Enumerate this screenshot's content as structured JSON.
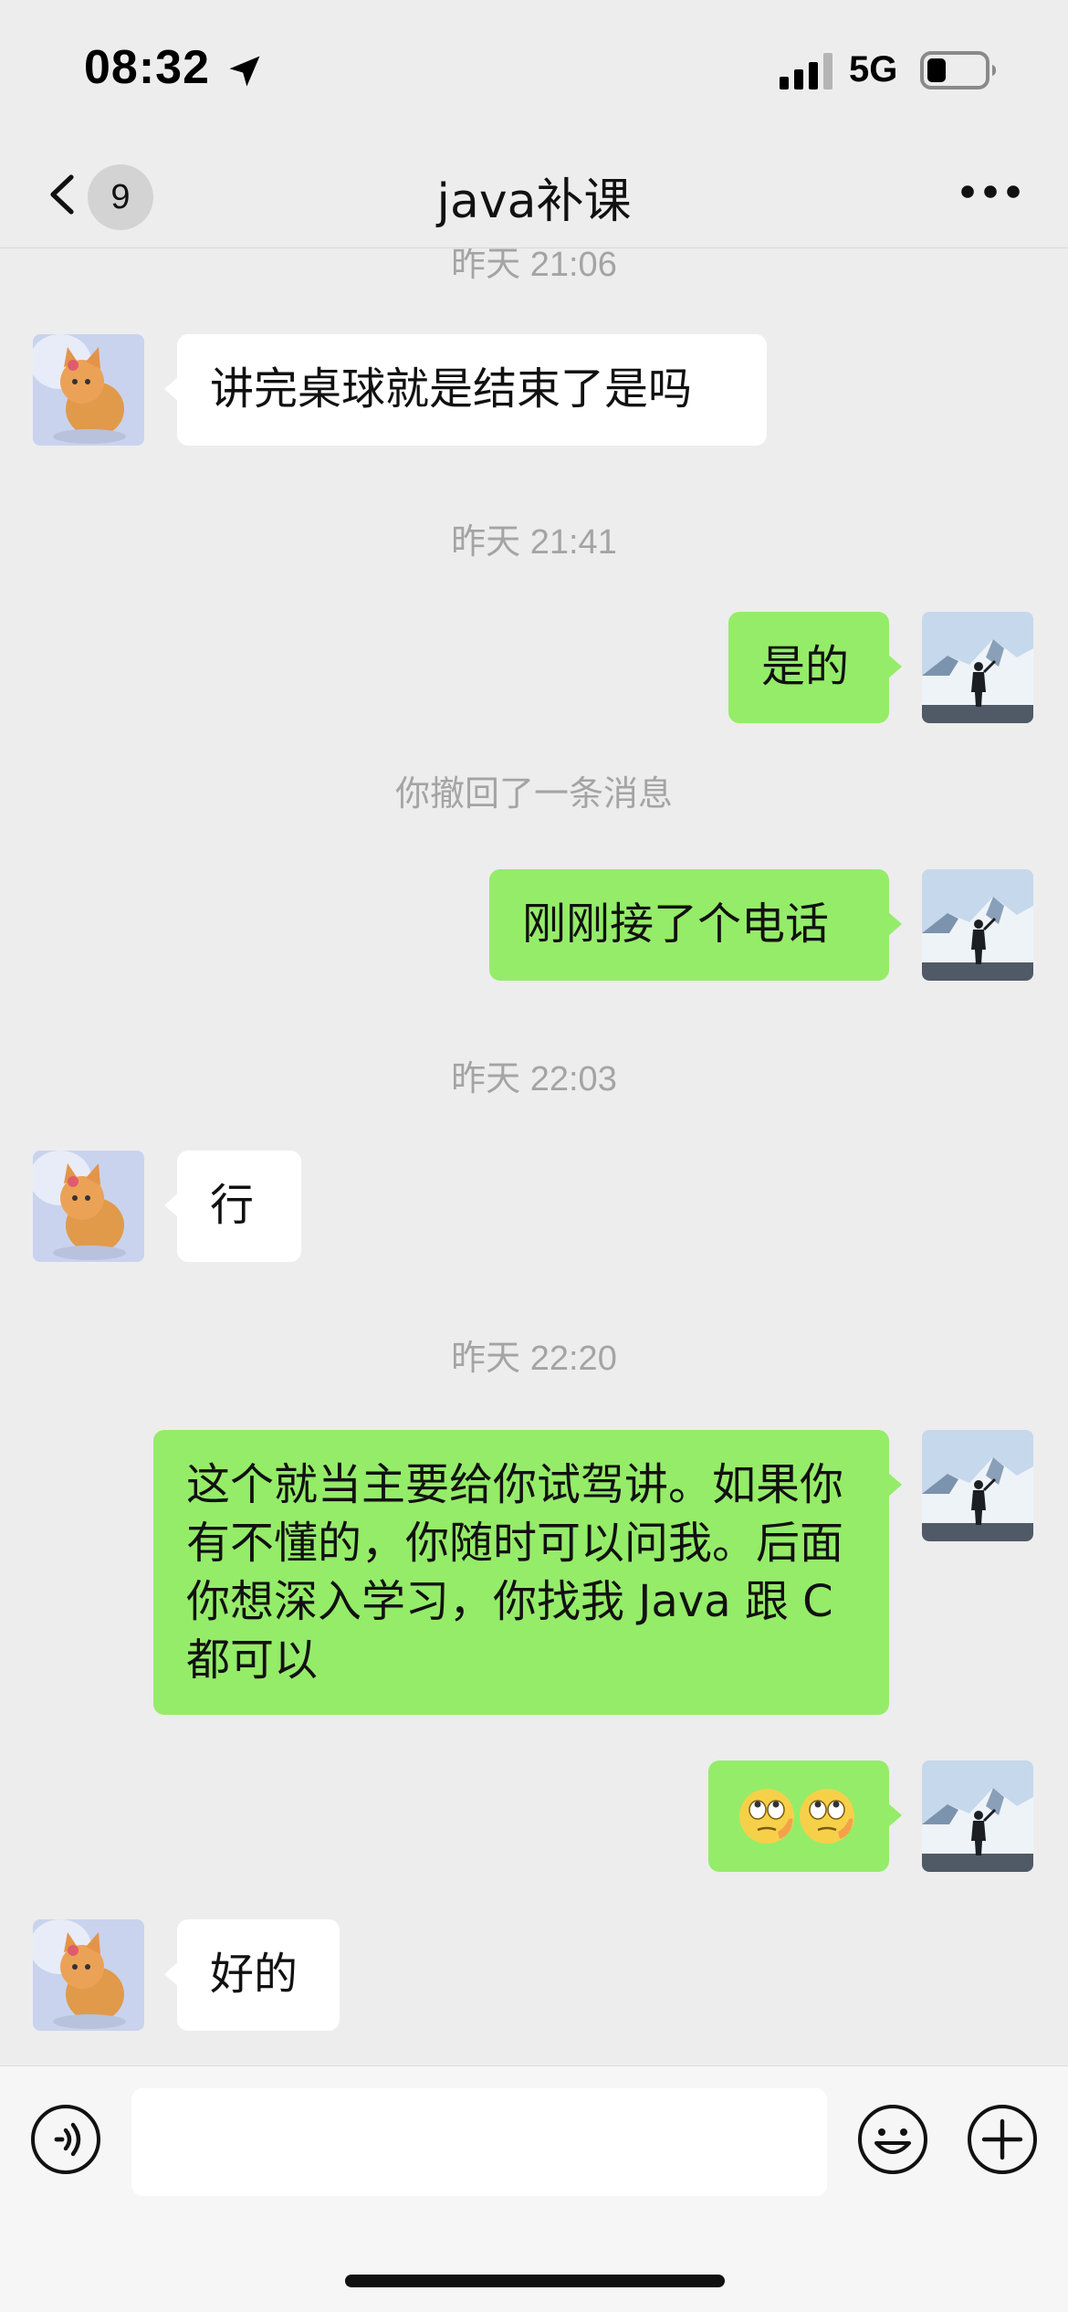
{
  "status_bar": {
    "time": "08:32",
    "network": "5G",
    "icons": [
      "location-arrow-icon",
      "signal-icon",
      "battery-icon"
    ]
  },
  "nav": {
    "unread_count": "9",
    "title": "java补课",
    "icons": [
      "chevron-left-icon",
      "more-icon"
    ]
  },
  "messages": {
    "ts_1": "昨天 21:06",
    "m1": "讲完桌球就是结束了是吗",
    "ts_2": "昨天 21:41",
    "m2": "是的",
    "system_recall": "你撤回了一条消息",
    "m3": "刚刚接了个电话",
    "ts_3": "昨天 22:03",
    "m4": "行",
    "ts_4": "昨天 22:20",
    "m5": "这个就当主要给你试驾讲。如果你有不懂的，你随时可以问我。后面你想深入学习，你找我 Java 跟 C 都可以",
    "m6_emoji": "🙄🙄",
    "m7": "好的"
  },
  "input_bar": {
    "placeholder": "",
    "icons": [
      "voice-icon",
      "emoji-icon",
      "plus-icon"
    ]
  },
  "colors": {
    "background": "#ededed",
    "bubble_self": "#95ec69",
    "bubble_other": "#ffffff",
    "timestamp": "#a4a4a4"
  }
}
